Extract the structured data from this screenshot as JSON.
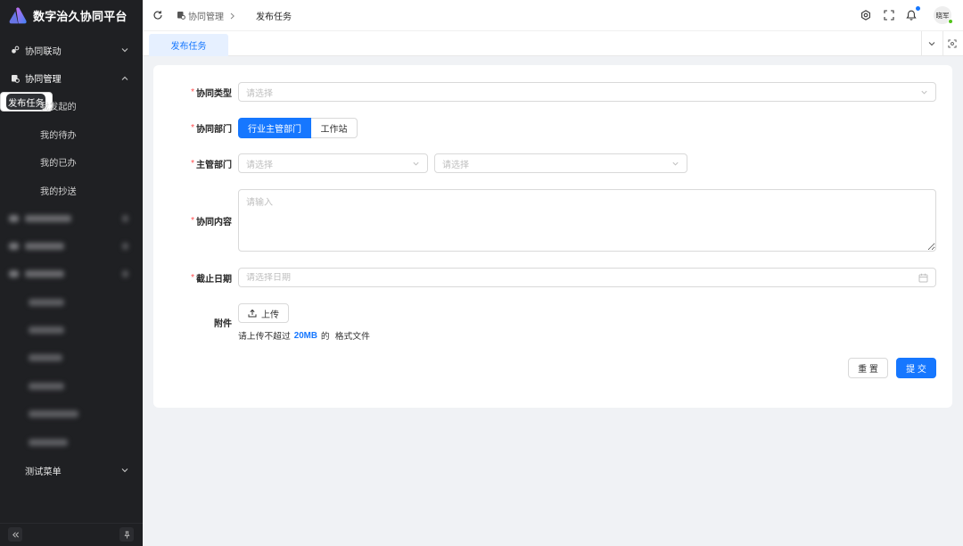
{
  "app": {
    "title": "数字治久协同平台",
    "logo_icon": "logo-icon"
  },
  "colors": {
    "primary": "#1677ff",
    "sidebar_bg": "#1f2023",
    "sidebar_selected_bg": "#2e3034",
    "page_bg": "#f0f2f5",
    "required": "#ff4d4f",
    "online": "#52c41a",
    "tab_active_bg": "#e6f0ff"
  },
  "sidebar": {
    "menu": [
      {
        "label": "协同联动",
        "icon": "collaboration-icon",
        "expanded": false
      },
      {
        "label": "协同管理",
        "icon": "management-icon",
        "expanded": true,
        "children": [
          {
            "label": "发布任务",
            "selected": true
          },
          {
            "label": "我发起的",
            "selected": false
          },
          {
            "label": "我的待办",
            "selected": false
          },
          {
            "label": "我的已办",
            "selected": false
          },
          {
            "label": "我的抄送",
            "selected": false
          }
        ]
      },
      {
        "label": "测试菜单",
        "expanded": false
      }
    ],
    "footer": {
      "collapse_icon": "double-chevron-left-icon",
      "pin_icon": "pin-icon"
    }
  },
  "header": {
    "refresh_icon": "refresh-icon",
    "breadcrumb": [
      {
        "label": "协同管理",
        "icon": "management-icon"
      },
      {
        "label": "发布任务"
      }
    ],
    "actions": [
      "settings-icon",
      "fullscreen-icon",
      "bell-icon"
    ],
    "has_unread_notifications": true,
    "user": {
      "avatar_text": "晓军",
      "online": true
    }
  },
  "tabs": {
    "items": [
      {
        "label": "发布任务",
        "active": true
      }
    ],
    "controls": [
      "chevron-down-icon",
      "focus-icon"
    ]
  },
  "form": {
    "required_mark": "*",
    "collab_type": {
      "label": "协同类型",
      "required": true,
      "placeholder": "请选择"
    },
    "collab_dept": {
      "label": "协同部门",
      "required": true,
      "options": [
        "行业主管部门",
        "工作站"
      ],
      "selected_index": 0
    },
    "supervisor_dept": {
      "label": "主管部门",
      "required": true,
      "placeholders": [
        "请选择",
        "请选择"
      ]
    },
    "content": {
      "label": "协同内容",
      "required": true,
      "placeholder": "请输入"
    },
    "deadline": {
      "label": "截止日期",
      "required": true,
      "placeholder": "请选择日期"
    },
    "attachment": {
      "label": "附件",
      "required": false,
      "button": "上传",
      "hint_prefix": "请上传不超过",
      "hint_size": "20MB",
      "hint_mid": "的",
      "hint_suffix": "格式文件"
    },
    "actions": {
      "reset": "重 置",
      "submit": "提 交"
    }
  }
}
